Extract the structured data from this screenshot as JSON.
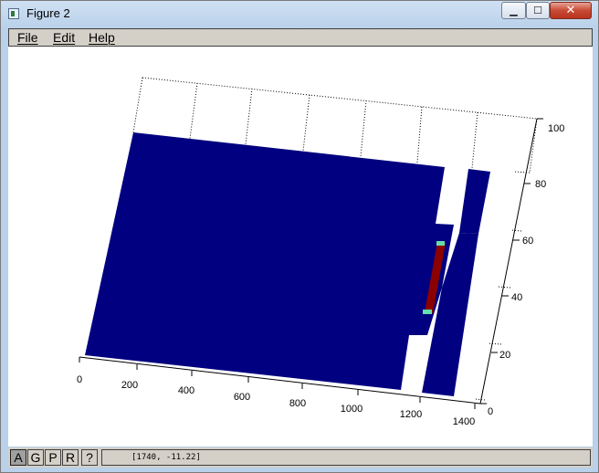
{
  "window": {
    "title": "Figure 2",
    "minimize_icon": "minimize-icon",
    "maximize_icon": "maximize-icon",
    "close_icon": "close-icon",
    "minimize_glyph": "▁",
    "maximize_glyph": "☐",
    "close_glyph": "✕"
  },
  "menu": [
    {
      "label": "File"
    },
    {
      "label": "Edit"
    },
    {
      "label": "Help"
    }
  ],
  "plot": {
    "x_ticks": [
      "0",
      "200",
      "400",
      "600",
      "800",
      "1000",
      "1200",
      "1400"
    ],
    "y_ticks": [
      "0",
      "20",
      "40",
      "60",
      "80",
      "100"
    ],
    "colors": {
      "surface": "#000080",
      "bar": "#8b0000",
      "bar_end": "#66ddaa"
    }
  },
  "toolbar": {
    "buttons": [
      {
        "label": "A",
        "active": true
      },
      {
        "label": "G"
      },
      {
        "label": "P"
      },
      {
        "label": "R"
      },
      {
        "label": "?"
      }
    ]
  },
  "status": {
    "coords": "[1740, -11.22]"
  }
}
